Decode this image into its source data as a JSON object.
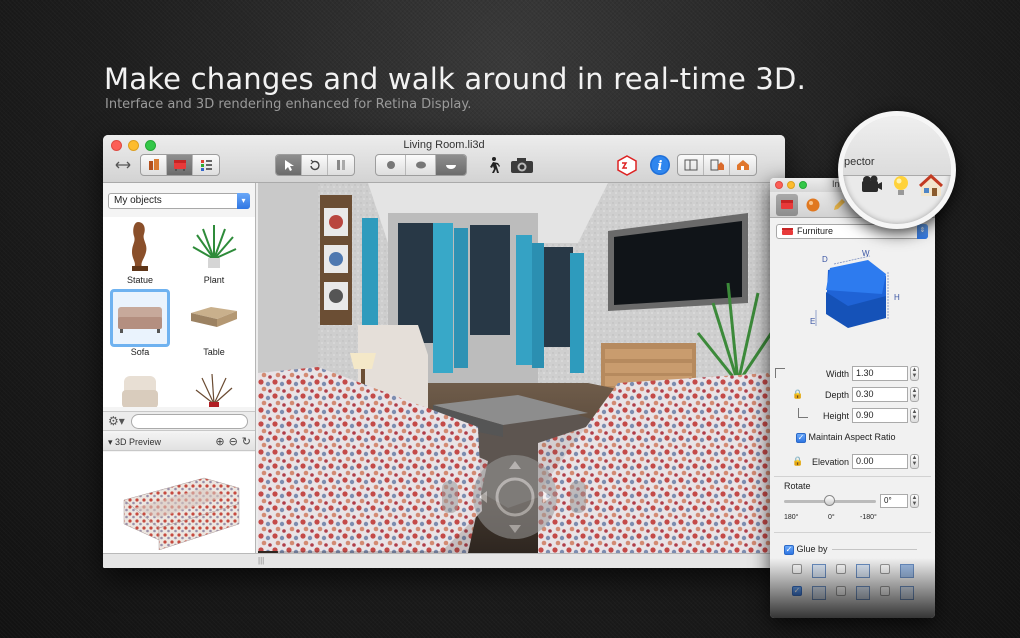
{
  "hero": {
    "headline": "Make changes and walk around in real-time 3D.",
    "subhead": "Interface and 3D rendering enhanced for Retina Display."
  },
  "window": {
    "title": "Living Room.li3d"
  },
  "sidebar": {
    "library_select": "My objects",
    "objects": [
      {
        "label": "Statue"
      },
      {
        "label": "Plant"
      },
      {
        "label": "Sofa"
      },
      {
        "label": "Table"
      },
      {
        "label": ""
      },
      {
        "label": ""
      }
    ],
    "preview_label": "3D Preview"
  },
  "inspector": {
    "title": "In",
    "magnified_title": "pector",
    "category": "Furniture",
    "dims": {
      "width_label": "Width",
      "width_value": "1.30",
      "depth_label": "Depth",
      "depth_value": "0.30",
      "height_label": "Height",
      "height_value": "0.90"
    },
    "aspect_label": "Maintain Aspect Ratio",
    "elevation_label": "Elevation",
    "elevation_value": "0.00",
    "rotate_label": "Rotate",
    "rotate_value": "0°",
    "rotate_ticks": [
      "180°",
      "0°",
      "-180°"
    ],
    "glue_label": "Glue by",
    "diagram_labels": {
      "w": "W",
      "d": "D",
      "h": "H",
      "e": "E"
    }
  },
  "colors": {
    "accent": "#2f76e3",
    "close": "#fc5f57",
    "minimize": "#fdbc2e",
    "zoom": "#33c748",
    "chair_blue": "#1f63d6"
  }
}
